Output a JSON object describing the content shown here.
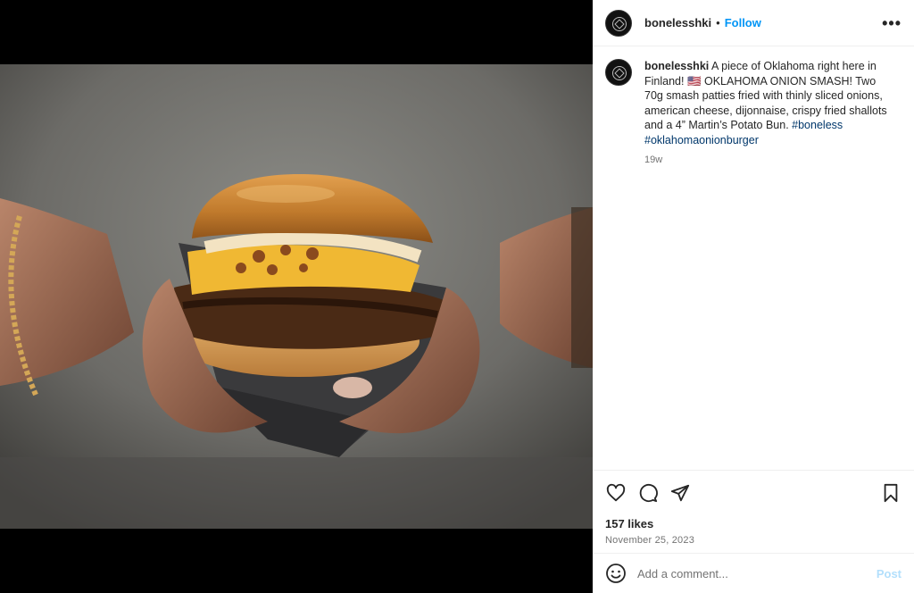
{
  "post": {
    "username": "bonelesshki",
    "separator": "•",
    "follow_label": "Follow",
    "more_label": "•••"
  },
  "caption": {
    "username": "bonelesshki",
    "text": " A piece of Oklahoma right here in Finland! 🇺🇸 OKLAHOMA ONION SMASH! Two 70g smash patties fried with thinly sliced onions, american cheese, dijonnaise, crispy fried shallots and a 4” Martin’s Potato Bun. ",
    "hashtag_1": "#boneless",
    "hashtag_2": "#oklahomaonionburger",
    "time_ago": "19w"
  },
  "engagement": {
    "likes": "157 likes",
    "date": "November 25, 2023"
  },
  "comment_box": {
    "placeholder": "Add a comment...",
    "post_label": "Post"
  },
  "icons": {
    "like": "heart-icon",
    "comment": "comment-icon",
    "share": "share-icon",
    "save": "bookmark-icon",
    "emoji": "emoji-icon",
    "more": "more-icon"
  },
  "colors": {
    "link_blue": "#0095f6",
    "hashtag": "#00376b",
    "muted": "#737373",
    "post_disabled": "#b2dffc"
  }
}
